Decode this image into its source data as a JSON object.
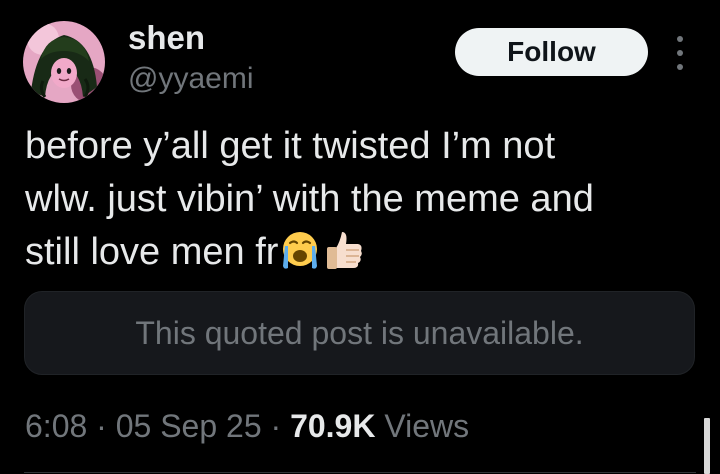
{
  "author": {
    "display_name": "shen",
    "handle": "@yyaemi",
    "avatar_icon": "pink-haired-avatar-icon"
  },
  "actions": {
    "follow_label": "Follow",
    "more_icon": "more-options-icon"
  },
  "tweet": {
    "lines": [
      "before y’all get it twisted I’m not",
      "wlw. just vibin’ with the meme and",
      "still love men fr"
    ],
    "emojis": [
      "loudly-crying-face-icon",
      "thumbs-up-icon"
    ]
  },
  "quote": {
    "text": "This quoted post is unavailable."
  },
  "meta": {
    "time": "6:08",
    "separator": "·",
    "date": "05 Sep 25",
    "views_count": "70.9K",
    "views_label": "Views"
  },
  "colors": {
    "background": "#000000",
    "primary_text": "#e7e9ea",
    "secondary_text": "#71767b",
    "follow_button_bg": "#eff3f4",
    "quote_box_bg": "#16181c"
  }
}
